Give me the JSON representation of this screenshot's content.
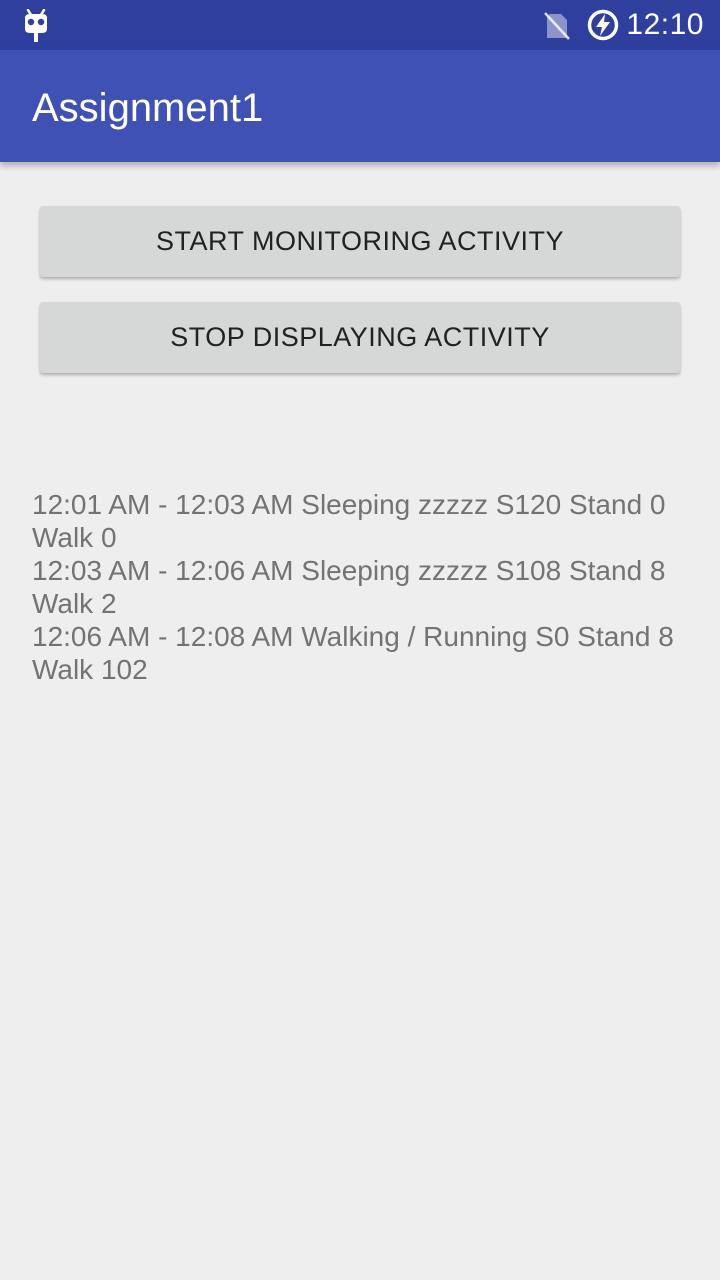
{
  "status_bar": {
    "time": "12:10",
    "left_icon": "android-debug-icon",
    "sim_icon": "no-sim-icon",
    "battery_icon": "battery-charging-icon"
  },
  "app_bar": {
    "title": "Assignment1",
    "color": "#3f51b5"
  },
  "buttons": {
    "start_label": "START MONITORING ACTIVITY",
    "stop_label": "STOP DISPLAYING ACTIVITY"
  },
  "activity_log": {
    "entries": [
      "12:01 AM - 12:03 AM Sleeping zzzzz S120 Stand 0 Walk 0",
      "12:03 AM - 12:06 AM Sleeping zzzzz S108 Stand 8 Walk 2",
      "12:06 AM - 12:08 AM Walking / Running S0 Stand 8 Walk 102"
    ]
  }
}
